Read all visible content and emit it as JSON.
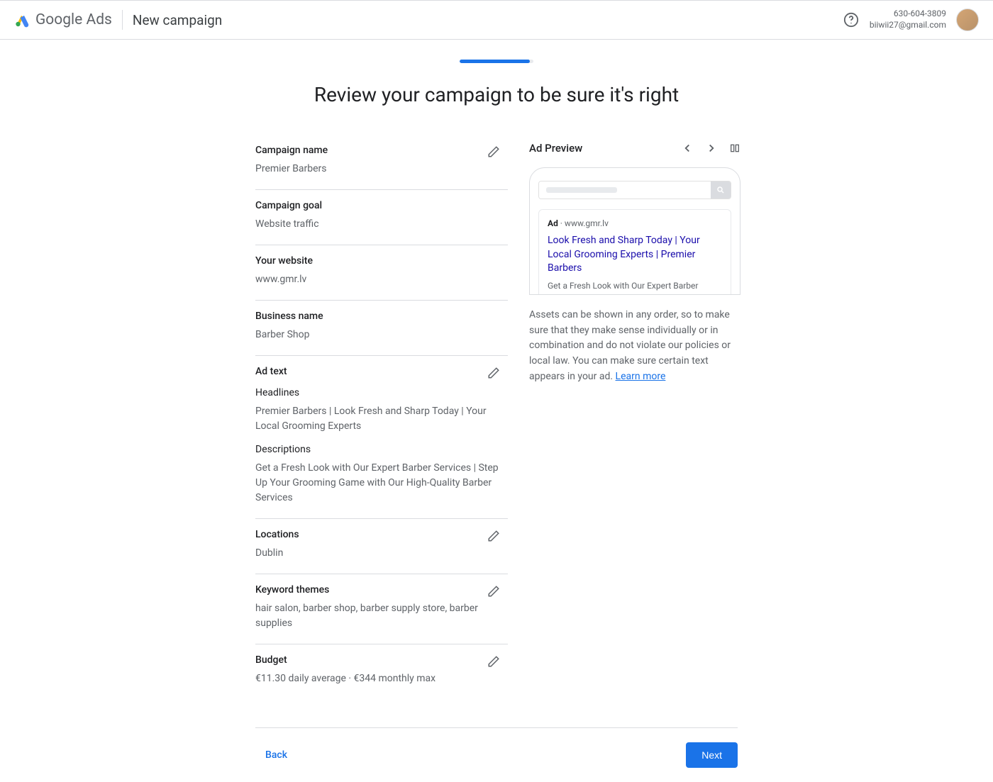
{
  "header": {
    "logo_text": "Google Ads",
    "page_context": "New campaign",
    "account_phone": "630-604-3809",
    "account_email": "biiwii27@gmail.com"
  },
  "page_title": "Review your campaign to be sure it's right",
  "sections": {
    "campaign_name": {
      "label": "Campaign name",
      "value": "Premier Barbers"
    },
    "campaign_goal": {
      "label": "Campaign goal",
      "value": "Website traffic"
    },
    "website": {
      "label": "Your website",
      "value": "www.gmr.lv"
    },
    "business_name": {
      "label": "Business name",
      "value": "Barber Shop"
    },
    "ad_text": {
      "label": "Ad text",
      "headlines_label": "Headlines",
      "headlines_value": "Premier Barbers | Look Fresh and Sharp Today | Your Local Grooming Experts",
      "descriptions_label": "Descriptions",
      "descriptions_value": "Get a Fresh Look with Our Expert Barber Services | Step Up Your Grooming Game with Our High-Quality Barber Services"
    },
    "locations": {
      "label": "Locations",
      "value": "Dublin"
    },
    "keywords": {
      "label": "Keyword themes",
      "value": "hair salon, barber shop, barber supply store, barber supplies"
    },
    "budget": {
      "label": "Budget",
      "value": "€11.30 daily average · €344 monthly max"
    }
  },
  "preview": {
    "title": "Ad Preview",
    "ad_badge_text": "Ad",
    "ad_separator": " · ",
    "ad_url": "www.gmr.lv",
    "headline": "Look Fresh and Sharp Today | Your Local Grooming Experts | Premier Barbers",
    "description": "Get a Fresh Look with Our Expert Barber Services. Step Up Your Grooming Game with Our High-Quality Barber Services.",
    "note_text": "Assets can be shown in any order, so to make sure that they make sense individually or in combination and do not violate our policies or local law. You can make sure certain text appears in your ad. ",
    "learn_more": "Learn more"
  },
  "footer": {
    "back": "Back",
    "next": "Next"
  }
}
